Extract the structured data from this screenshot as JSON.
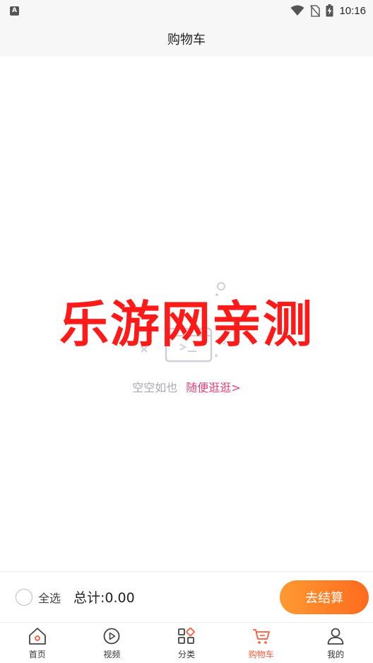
{
  "status_bar": {
    "left_badge": "A",
    "time": "10:16",
    "icons": [
      "wifi-icon",
      "no-sim-icon",
      "battery-charging-icon"
    ]
  },
  "header": {
    "title": "购物车"
  },
  "empty_state": {
    "message": "空空如也",
    "link_label": "随便逛逛>",
    "illustration_icon": "empty-box-icon"
  },
  "watermark": {
    "text": "乐游网亲测"
  },
  "checkout": {
    "select_all_label": "全选",
    "total_text": "总计:0.00",
    "button_label": "去结算"
  },
  "tabs": [
    {
      "label": "首页",
      "icon": "home-icon"
    },
    {
      "label": "视频",
      "icon": "video-play-icon"
    },
    {
      "label": "分类",
      "icon": "category-grid-icon"
    },
    {
      "label": "购物车",
      "icon": "cart-icon",
      "active": true
    },
    {
      "label": "我的",
      "icon": "profile-icon"
    }
  ],
  "colors": {
    "accent": "#ff5a3c",
    "link": "#e8437a",
    "button_start": "#ff9a32",
    "button_end": "#ff6b1e",
    "watermark": "#ff1a1a"
  }
}
